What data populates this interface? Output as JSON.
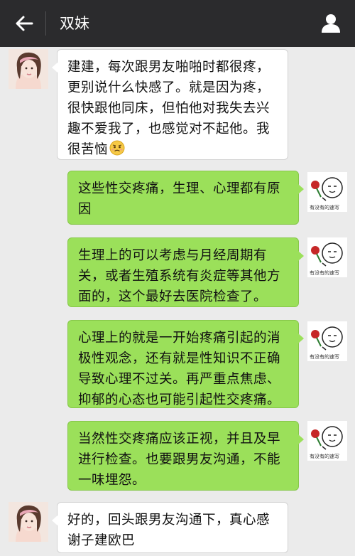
{
  "header": {
    "title": "双妹",
    "back_icon": "back-arrow-icon",
    "profile_icon": "person-icon"
  },
  "colors": {
    "header_bg": "#2b2b2d",
    "chat_bg": "#ebebeb",
    "incoming_bubble": "#ffffff",
    "outgoing_bubble": "#9be05a"
  },
  "messages": [
    {
      "side": "left",
      "text": "建建，每次跟男友啪啪时都很疼，更别说什么快感了。就是因为疼，很快跟他同床，但怕他对我失去兴趣不爱我了，也感觉对不起他。我很苦恼",
      "emoji": "worried-face-emoji"
    },
    {
      "side": "right",
      "text": "这些性交疼痛，生理、心理都有原因"
    },
    {
      "side": "right",
      "text": "生理上的可以考虑与月经周期有关，或者生殖系统有炎症等其他方面的，这个最好去医院检查了。"
    },
    {
      "side": "right",
      "text": "心理上的就是一开始疼痛引起的消极性观念，还有就是性知识不正确导致心理不过关。再严重点焦虑、抑郁的心态也可能引起性交疼痛。"
    },
    {
      "side": "right",
      "text": "当然性交疼痛应该正视，并且及早进行检查。也要跟男友沟通，不能一味埋怨。"
    },
    {
      "side": "left",
      "text": "好的，回头跟男友沟通下，真心感谢子建欧巴"
    }
  ],
  "avatars": {
    "left_image": "girl-portrait-avatar",
    "right_image": "cartoon-face-with-rose-avatar",
    "right_caption": "有没有的速写"
  }
}
